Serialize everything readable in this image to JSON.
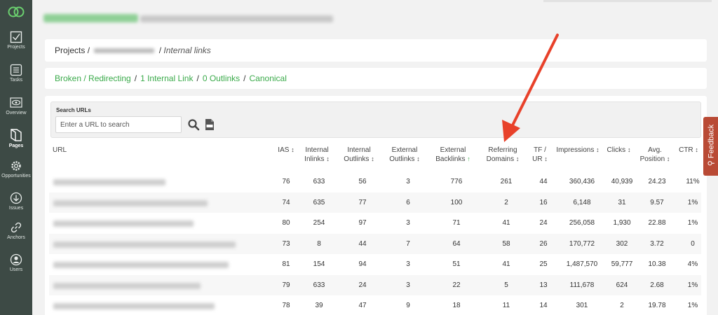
{
  "sidebar": {
    "items": [
      {
        "label": "Projects",
        "icon": "checkbox-icon"
      },
      {
        "label": "Tasks",
        "icon": "list-icon"
      },
      {
        "label": "Overview",
        "icon": "eye-icon"
      },
      {
        "label": "Pages",
        "icon": "pages-icon",
        "active": true
      },
      {
        "label": "Opportunities",
        "icon": "gear-icon"
      },
      {
        "label": "Issues",
        "icon": "arrow-circle-icon"
      },
      {
        "label": "Anchors",
        "icon": "link-icon"
      },
      {
        "label": "Users",
        "icon": "user-icon"
      }
    ]
  },
  "breadcrumb": {
    "projects": "Projects",
    "sep1": "/",
    "sep2": "/",
    "current": "Internal links"
  },
  "filters": {
    "items": [
      "Broken / Redirecting",
      "1 Internal Link",
      "0 Outlinks",
      "Canonical"
    ],
    "separator": "/"
  },
  "search": {
    "label": "Search URLs",
    "placeholder": "Enter a URL to search"
  },
  "table": {
    "headers": {
      "url": "URL",
      "ias_1": "IAS",
      "internal_inlinks_1": "Internal",
      "internal_inlinks_2": "Inlinks",
      "internal_outlinks_1": "Internal",
      "internal_outlinks_2": "Outlinks",
      "external_outlinks_1": "External",
      "external_outlinks_2": "Outlinks",
      "external_backlinks_1": "External",
      "external_backlinks_2": "Backlinks",
      "referring_domains_1": "Referring",
      "referring_domains_2": "Domains",
      "tf_ur_1": "TF /",
      "tf_ur_2": "UR",
      "impressions": "Impressions",
      "clicks": "Clicks",
      "avg_position_1": "Avg.",
      "avg_position_2": "Position",
      "ctr": "CTR"
    },
    "rows": [
      {
        "ias": "76",
        "inlinks": "633",
        "outlinks": "56",
        "ext_outlinks": "3",
        "backlinks": "776",
        "ref_domains": "261",
        "tf_ur": "44",
        "impressions": "360,436",
        "clicks": "40,939",
        "position": "24.23",
        "ctr": "11%"
      },
      {
        "ias": "74",
        "inlinks": "635",
        "outlinks": "77",
        "ext_outlinks": "6",
        "backlinks": "100",
        "ref_domains": "2",
        "tf_ur": "16",
        "impressions": "6,148",
        "clicks": "31",
        "position": "9.57",
        "ctr": "1%"
      },
      {
        "ias": "80",
        "inlinks": "254",
        "outlinks": "97",
        "ext_outlinks": "3",
        "backlinks": "71",
        "ref_domains": "41",
        "tf_ur": "24",
        "impressions": "256,058",
        "clicks": "1,930",
        "position": "22.88",
        "ctr": "1%"
      },
      {
        "ias": "73",
        "inlinks": "8",
        "outlinks": "44",
        "ext_outlinks": "7",
        "backlinks": "64",
        "ref_domains": "58",
        "tf_ur": "26",
        "impressions": "170,772",
        "clicks": "302",
        "position": "3.72",
        "ctr": "0"
      },
      {
        "ias": "81",
        "inlinks": "154",
        "outlinks": "94",
        "ext_outlinks": "3",
        "backlinks": "51",
        "ref_domains": "41",
        "tf_ur": "25",
        "impressions": "1,487,570",
        "clicks": "59,777",
        "position": "10.38",
        "ctr": "4%"
      },
      {
        "ias": "79",
        "inlinks": "633",
        "outlinks": "24",
        "ext_outlinks": "3",
        "backlinks": "22",
        "ref_domains": "5",
        "tf_ur": "13",
        "impressions": "111,678",
        "clicks": "624",
        "position": "2.68",
        "ctr": "1%"
      },
      {
        "ias": "78",
        "inlinks": "39",
        "outlinks": "47",
        "ext_outlinks": "9",
        "backlinks": "18",
        "ref_domains": "11",
        "tf_ur": "14",
        "impressions": "301",
        "clicks": "2",
        "position": "19.78",
        "ctr": "1%"
      }
    ]
  },
  "feedback": {
    "label": "Feedback",
    "icon": "lightbulb-icon"
  },
  "colors": {
    "accent": "#3aaa4a",
    "sidebar": "#3d4a45",
    "feedback": "#b94a35",
    "arrow": "#e8412a"
  }
}
